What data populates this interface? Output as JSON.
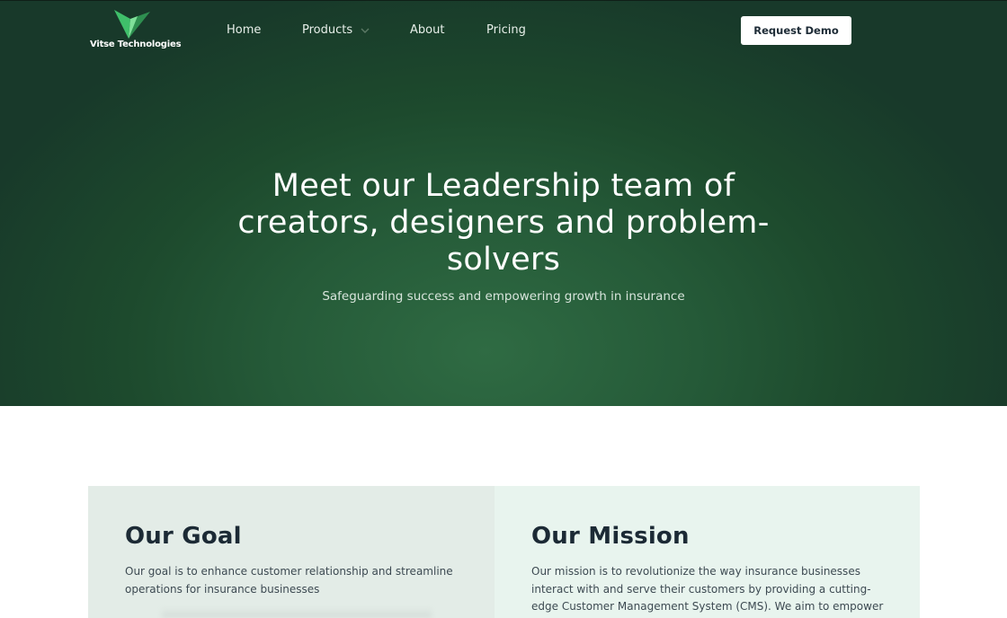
{
  "brand": {
    "name": "Vitse Technologies",
    "logo_icon": "v-check-logo-icon",
    "logo_colors": [
      "#3fbf6a",
      "#2e8f50",
      "#7fe09a"
    ]
  },
  "nav": {
    "items": [
      {
        "label": "Home"
      },
      {
        "label": "Products",
        "icon": "chevron-down-icon"
      },
      {
        "label": "About"
      },
      {
        "label": "Pricing"
      }
    ],
    "cta_label": "Request Demo"
  },
  "hero": {
    "title": "Meet our Leadership team of creators, designers and problem-solvers",
    "subtitle": "Safeguarding success and empowering growth in insurance",
    "gradient_colors": [
      "#2f6b43",
      "#18392a"
    ]
  },
  "goal": {
    "heading": "Our Goal",
    "text": "Our goal is to enhance customer relationship and streamline operations for insurance businesses"
  },
  "mission": {
    "heading": "Our Mission",
    "text": "Our mission is to revolutionize the way insurance businesses interact with and serve their customers by providing a cutting-edge Customer Management System (CMS). We aim to empower"
  }
}
